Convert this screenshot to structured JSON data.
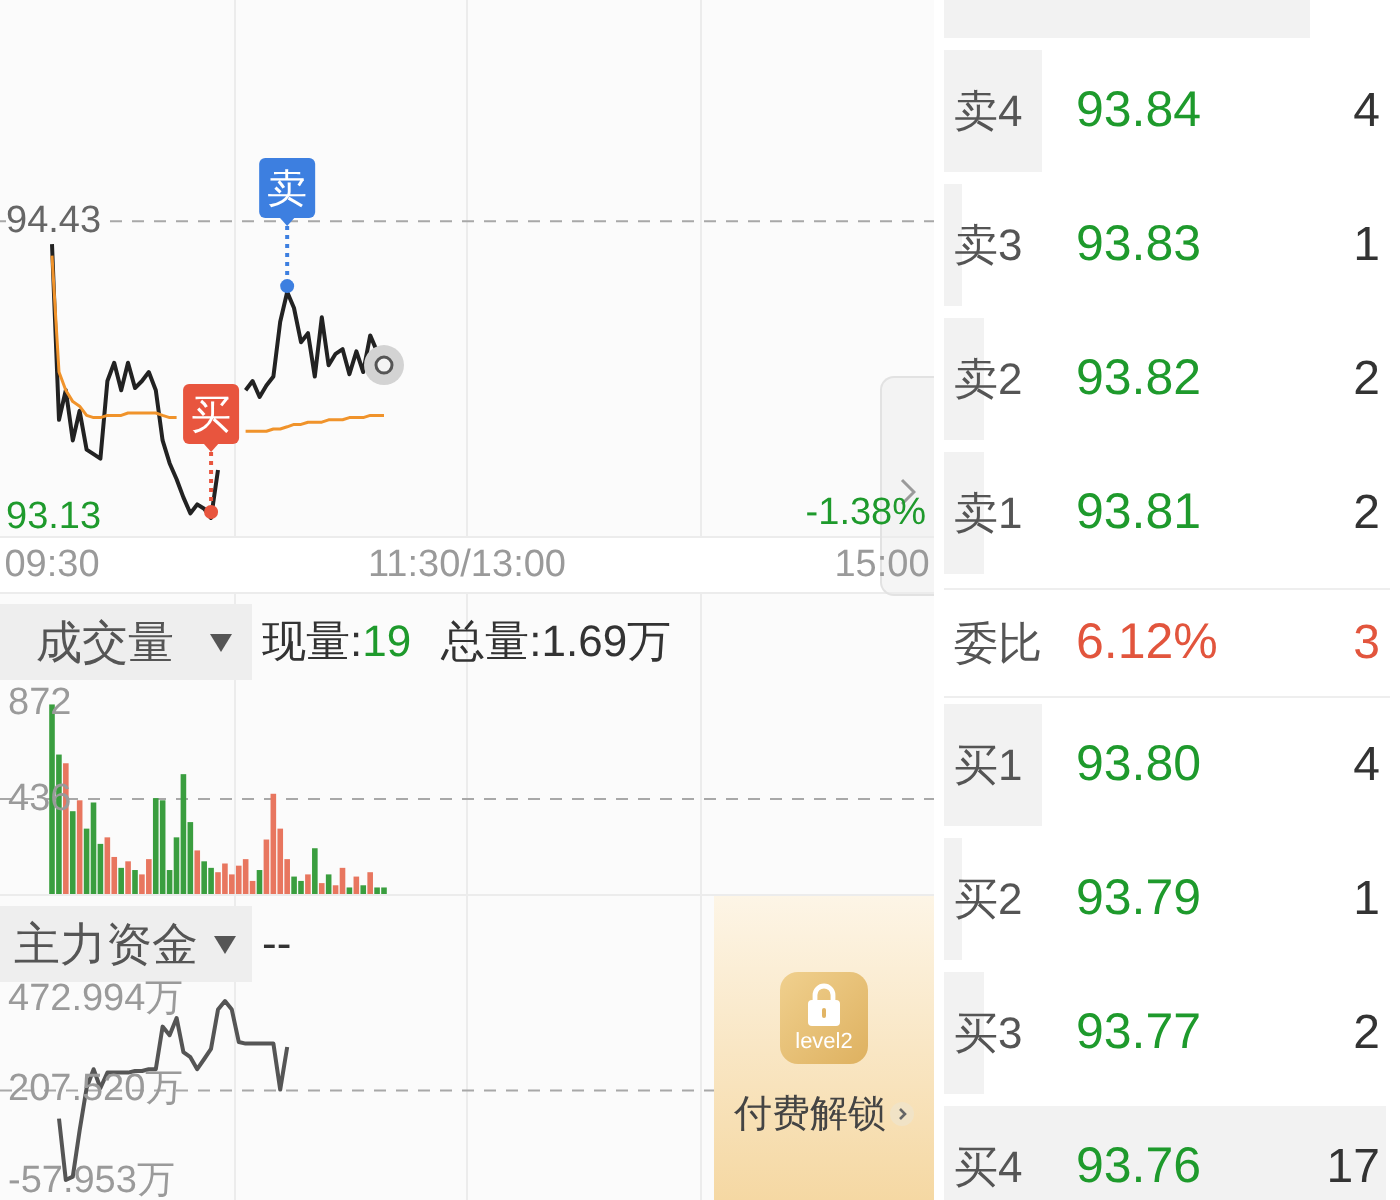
{
  "price_chart": {
    "change": {
      "text": "-1.38%",
      "falling": true
    },
    "markers": [
      {
        "kind": "sell"
      },
      {
        "kind": "buy"
      }
    ],
    "chart_data": {
      "type": "line",
      "categories": [
        "09:30",
        null,
        null,
        null,
        null,
        null,
        null,
        null,
        null,
        null,
        null,
        null,
        null,
        null,
        null,
        null,
        null,
        null,
        null,
        null,
        null,
        null,
        null,
        null,
        null,
        null,
        null,
        null,
        null,
        null,
        null,
        null,
        null,
        null,
        null,
        null,
        null,
        null,
        null,
        null,
        null,
        null,
        null,
        null,
        null,
        null,
        null,
        null,
        null,
        null,
        null,
        null,
        null,
        null,
        null,
        null,
        null,
        null,
        null,
        null,
        "11:30/13:00",
        null,
        null,
        null,
        null,
        null,
        null,
        null,
        null,
        null,
        null,
        null,
        null,
        null,
        null,
        null,
        null,
        null,
        null,
        null,
        null,
        null,
        null,
        null,
        null,
        null,
        null,
        null,
        null,
        null,
        null,
        null,
        null,
        null,
        null,
        null,
        null,
        null,
        null,
        null,
        null,
        null,
        null,
        null,
        null,
        null,
        null,
        null,
        null,
        null,
        null,
        null,
        null,
        null,
        null,
        null,
        null,
        null,
        null,
        null,
        "15:00"
      ],
      "series": [
        {
          "color": "#222222",
          "values": [
            94.33,
            93.56,
            93.69,
            93.47,
            93.6,
            93.43,
            93.41,
            93.39,
            93.73,
            93.81,
            93.69,
            93.81,
            93.7,
            93.73,
            93.77,
            93.69,
            93.47,
            93.37,
            93.3,
            93.22,
            93.15,
            93.19,
            93.17,
            93.13,
            93.34,
            null,
            null,
            null,
            93.69,
            93.73,
            93.66,
            93.71,
            93.75,
            93.99,
            94.12,
            94.05,
            93.9,
            93.94,
            93.75,
            94.01,
            93.8,
            93.85,
            93.87,
            93.76,
            93.86,
            93.77,
            93.93,
            93.86,
            93.8,
            null,
            null,
            null,
            null,
            null,
            null,
            null,
            null,
            null,
            null,
            null,
            null,
            null,
            null,
            null,
            null,
            null,
            null,
            null,
            null,
            null,
            null,
            null,
            null,
            null,
            null,
            null,
            null,
            null,
            null,
            null,
            null,
            null,
            null,
            null,
            null,
            null,
            null,
            null,
            null,
            null,
            null,
            null,
            null,
            null,
            null,
            null,
            null,
            null,
            null,
            null,
            null,
            null,
            null,
            null,
            null,
            null,
            null,
            null,
            null,
            null,
            null,
            null,
            null,
            null,
            null,
            null,
            null,
            null,
            null,
            null,
            null
          ]
        },
        {
          "color": "#f0932b",
          "values": [
            94.28,
            93.77,
            93.69,
            93.64,
            93.62,
            93.58,
            93.57,
            93.57,
            93.58,
            93.58,
            93.58,
            93.59,
            93.59,
            93.59,
            93.59,
            93.59,
            93.58,
            93.57,
            93.57,
            null,
            null,
            null,
            null,
            null,
            null,
            null,
            null,
            null,
            93.51,
            93.51,
            93.51,
            93.51,
            93.52,
            93.52,
            93.53,
            93.54,
            93.54,
            93.55,
            93.55,
            93.55,
            93.56,
            93.56,
            93.56,
            93.57,
            93.57,
            93.57,
            93.58,
            93.58,
            93.58,
            null,
            null,
            null,
            null,
            null,
            null,
            null,
            null,
            null,
            null,
            null,
            null,
            null,
            null,
            null,
            null,
            null,
            null,
            null,
            null,
            null,
            null,
            null,
            null,
            null,
            null,
            null,
            null,
            null,
            null,
            null,
            null,
            null,
            null,
            null,
            null,
            null,
            null,
            null,
            null,
            null,
            null,
            null,
            null,
            null,
            null,
            null,
            null,
            null,
            null,
            null,
            null,
            null,
            null,
            null,
            null,
            null,
            null,
            null,
            null,
            null,
            null,
            null,
            null,
            null,
            null,
            null,
            null,
            null,
            null,
            null,
            null
          ]
        }
      ],
      "ylim": [
        93.13,
        95.4
      ],
      "yticks": [
        {
          "value": 94.43,
          "label": "94.43"
        },
        {
          "value": 93.13,
          "label": "93.13"
        }
      ],
      "annotations": [
        {
          "text": "卖",
          "y": 94.12
        },
        {
          "text": "买",
          "y": 93.13
        }
      ]
    }
  },
  "volume_panel": {
    "title": "成交量",
    "current": {
      "label": "现量:",
      "value": "19",
      "falling": true
    },
    "total": {
      "label": "总量:",
      "value": "1.69万"
    },
    "chart_data": {
      "type": "bar",
      "categories": [
        null,
        null,
        null,
        null,
        null,
        null,
        null,
        null,
        null,
        null,
        null,
        null,
        null,
        null,
        null,
        null,
        null,
        null,
        null,
        null,
        null,
        null,
        null,
        null,
        null,
        null,
        null,
        null,
        null,
        null,
        null,
        null,
        null,
        null,
        null,
        null,
        null,
        null,
        null,
        null,
        null,
        null,
        null,
        null,
        null,
        null,
        null,
        null,
        null,
        null,
        null,
        null,
        null,
        null,
        null,
        null,
        null,
        null,
        null,
        null,
        null,
        null,
        null,
        null,
        null,
        null,
        null,
        null,
        null,
        null,
        null,
        null,
        null,
        null,
        null,
        null,
        null,
        null,
        null,
        null,
        null,
        null,
        null,
        null,
        null,
        null,
        null,
        null,
        null,
        null,
        null,
        null,
        null,
        null,
        null,
        null,
        null,
        null,
        null,
        null,
        null,
        null,
        null,
        null,
        null,
        null,
        null,
        null,
        null,
        null,
        null,
        null,
        null,
        null,
        null,
        null,
        null,
        null,
        null,
        null,
        null
      ],
      "values": [
        870,
        640,
        600,
        380,
        430,
        300,
        420,
        230,
        260,
        170,
        120,
        150,
        110,
        90,
        160,
        440,
        430,
        110,
        260,
        550,
        330,
        200,
        150,
        120,
        100,
        140,
        90,
        130,
        160,
        60,
        110,
        250,
        460,
        300,
        160,
        80,
        60,
        90,
        210,
        50,
        90,
        40,
        120,
        30,
        80,
        40,
        100,
        30,
        30,
        null,
        null,
        null,
        null,
        null,
        null,
        null,
        null,
        null,
        null,
        null,
        null,
        null,
        null,
        null,
        null,
        null,
        null,
        null,
        null,
        null,
        null,
        null,
        null,
        null,
        null,
        null,
        null,
        null,
        null,
        null,
        null,
        null,
        null,
        null,
        null,
        null,
        null,
        null,
        null,
        null,
        null,
        null,
        null,
        null,
        null,
        null,
        null,
        null,
        null,
        null,
        null,
        null,
        null,
        null,
        null,
        null,
        null,
        null,
        null,
        null,
        null,
        null,
        null,
        null,
        null,
        null,
        null,
        null,
        null,
        null,
        null
      ],
      "ylim": [
        0,
        872
      ],
      "yticks": [
        {
          "value": 872,
          "label": "872"
        },
        {
          "value": 436,
          "label": "436"
        }
      ]
    }
  },
  "funds_panel": {
    "title": "主力资金",
    "value": "--",
    "chart_data": {
      "type": "line",
      "categories": [
        null,
        null,
        null,
        null,
        null,
        null,
        null,
        null,
        null,
        null,
        null,
        null,
        null,
        null,
        null,
        null,
        null,
        null,
        null,
        null,
        null,
        null,
        null,
        null,
        null,
        null,
        null,
        null,
        null,
        null,
        null,
        null,
        null,
        null,
        null,
        null,
        null,
        null,
        null,
        null,
        null,
        null,
        null,
        null,
        null,
        null,
        null,
        null,
        null,
        null,
        null,
        null,
        null,
        null,
        null,
        null,
        null,
        null,
        null,
        null,
        null,
        null,
        null,
        null,
        null,
        null,
        null,
        null,
        null,
        null,
        null,
        null,
        null,
        null,
        null,
        null,
        null,
        null,
        null,
        null,
        null,
        null,
        null,
        null,
        null,
        null,
        null,
        null,
        null,
        null,
        null,
        null,
        null,
        null,
        null,
        null,
        null,
        null,
        null,
        null,
        null,
        null,
        null,
        null,
        null,
        null,
        null,
        null,
        null,
        null,
        null,
        null,
        null,
        null,
        null,
        null,
        null,
        null,
        null,
        null,
        null
      ],
      "series": [
        {
          "color": "#555555",
          "values": [
            null,
            125,
            -55,
            -45,
            90,
            215,
            270,
            215,
            260,
            260,
            260,
            260,
            265,
            265,
            270,
            270,
            395,
            370,
            420,
            320,
            305,
            270,
            300,
            330,
            445,
            470,
            445,
            350,
            345,
            345,
            345,
            345,
            345,
            210,
            335,
            null,
            null,
            null,
            null,
            null,
            null,
            null,
            null,
            null,
            null,
            null,
            null,
            null,
            null,
            null,
            null,
            null,
            null,
            null,
            null,
            null,
            null,
            null,
            null,
            null,
            null,
            null,
            null,
            null,
            null,
            null,
            null,
            null,
            null,
            null,
            null,
            null,
            null,
            null,
            null,
            null,
            null,
            null,
            null,
            null,
            null,
            null,
            null,
            null,
            null,
            null,
            null,
            null,
            null,
            null,
            null,
            null,
            null,
            null,
            null,
            null,
            null,
            null,
            null,
            null,
            null,
            null,
            null,
            null,
            null,
            null,
            null,
            null,
            null,
            null,
            null,
            null,
            null,
            null,
            null,
            null,
            null,
            null,
            null,
            null,
            null
          ]
        }
      ],
      "ylim": [
        -113.4,
        472.994
      ],
      "yticks": [
        {
          "value": 472.994,
          "label": "472.994万"
        },
        {
          "value": 207.52,
          "label": "207.520万"
        },
        {
          "value": -57.953,
          "label": "-57.953万"
        }
      ]
    },
    "unlock": {
      "badge": "level2",
      "label": "付费解锁"
    }
  },
  "order_book": {
    "partial_row": {
      "level": 0.82
    },
    "asks": [
      {
        "label": "卖4",
        "price": "93.84",
        "volume": "4",
        "falling": true,
        "level": 0.22
      },
      {
        "label": "卖3",
        "price": "93.83",
        "volume": "1",
        "falling": true,
        "level": 0.04
      },
      {
        "label": "卖2",
        "price": "93.82",
        "volume": "2",
        "falling": true,
        "level": 0.09
      },
      {
        "label": "卖1",
        "price": "93.81",
        "volume": "2",
        "falling": true,
        "level": 0.09
      }
    ],
    "ratio": {
      "label": "委比",
      "value": "6.12%",
      "volume": "3",
      "falling": false
    },
    "bids": [
      {
        "label": "买1",
        "price": "93.80",
        "volume": "4",
        "falling": true,
        "level": 0.22
      },
      {
        "label": "买2",
        "price": "93.79",
        "volume": "1",
        "falling": true,
        "level": 0.04
      },
      {
        "label": "买3",
        "price": "93.77",
        "volume": "2",
        "falling": true,
        "level": 0.09
      },
      {
        "label": "买4",
        "price": "93.76",
        "volume": "17",
        "falling": true,
        "level": 0.99
      }
    ]
  }
}
